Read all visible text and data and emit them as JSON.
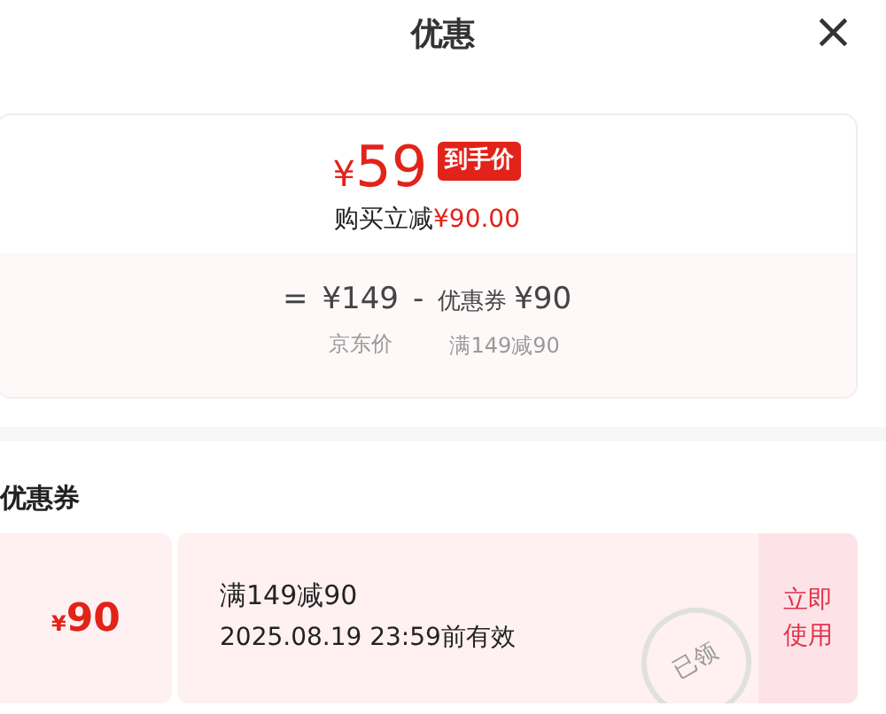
{
  "header": {
    "title": "优惠",
    "close": "×"
  },
  "summary": {
    "currency": "¥",
    "price": "59",
    "tag": "到手价",
    "saving_label": "购买立减",
    "saving_amount": "¥90.00",
    "formula": [
      {
        "kind": "op",
        "text": "="
      },
      {
        "kind": "amount",
        "text": "¥149",
        "caption": "京东价"
      },
      {
        "kind": "op",
        "text": "-"
      },
      {
        "kind": "coupon",
        "label": "优惠券",
        "text": "¥90",
        "caption": "满149减90"
      }
    ]
  },
  "coupons_section": {
    "title": "优惠券",
    "coupons": [
      {
        "currency": "¥",
        "amount": "90",
        "condition": "满149减90",
        "validity": "2025.08.19 23:59前有效",
        "stamp": "已领",
        "claimed": true,
        "action": "立即使用"
      }
    ]
  }
}
